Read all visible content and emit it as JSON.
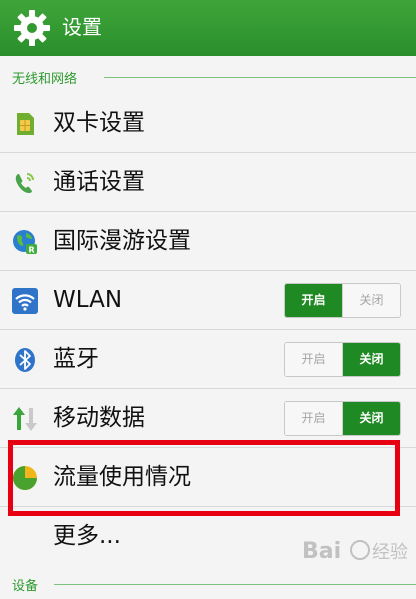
{
  "header": {
    "title": "设置",
    "icon": "gear-icon",
    "bar_color": "#2f9a2f"
  },
  "sections": {
    "wireless": "无线和网络",
    "device": "设备"
  },
  "rows": {
    "dual_sim": {
      "label": "双卡设置",
      "icon": "sim-card-icon"
    },
    "call": {
      "label": "通话设置",
      "icon": "phone-icon"
    },
    "roaming": {
      "label": "国际漫游设置",
      "icon": "globe-icon"
    },
    "wlan": {
      "label": "WLAN",
      "icon": "wifi-icon",
      "on_label": "开启",
      "off_label": "关闭",
      "state": "on"
    },
    "bluetooth": {
      "label": "蓝牙",
      "icon": "bluetooth-icon",
      "on_label": "开启",
      "off_label": "关闭",
      "state": "off"
    },
    "mobile_data": {
      "label": "移动数据",
      "icon": "data-arrows-icon",
      "on_label": "开启",
      "off_label": "关闭",
      "state": "off"
    },
    "data_usage": {
      "label": "流量使用情况",
      "icon": "pie-chart-icon"
    },
    "more": {
      "label": "更多..."
    }
  },
  "colors": {
    "accent": "#1f8a24",
    "highlight": "#e60012"
  },
  "watermark": "Bai 经验"
}
